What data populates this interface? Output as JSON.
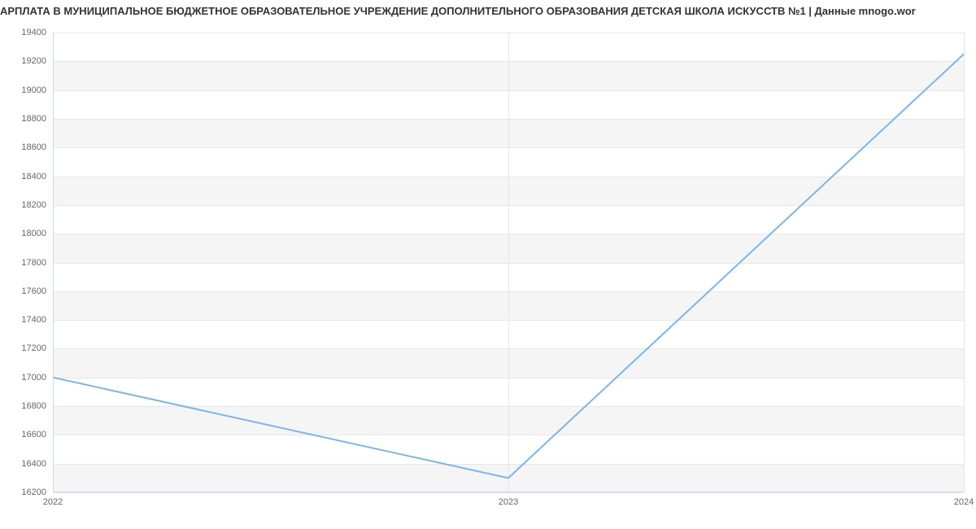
{
  "chart_data": {
    "type": "line",
    "title": "АРПЛАТА В МУНИЦИПАЛЬНОЕ БЮДЖЕТНОЕ ОБРАЗОВАТЕЛЬНОЕ УЧРЕЖДЕНИЕ ДОПОЛНИТЕЛЬНОГО ОБРАЗОВАНИЯ  ДЕТСКАЯ ШКОЛА ИСКУССТВ №1 | Данные mnogo.wor",
    "x": [
      2022,
      2023,
      2024
    ],
    "values": [
      17000,
      16300,
      19250
    ],
    "xlabel": "",
    "ylabel": "",
    "xlim": [
      2022,
      2024
    ],
    "ylim": [
      16200,
      19400
    ],
    "y_ticks": [
      16200,
      16400,
      16600,
      16800,
      17000,
      17200,
      17400,
      17600,
      17800,
      18000,
      18200,
      18400,
      18600,
      18800,
      19000,
      19200,
      19400
    ],
    "x_ticks": [
      2022,
      2023,
      2024
    ],
    "series_color": "#7cb5ec"
  }
}
